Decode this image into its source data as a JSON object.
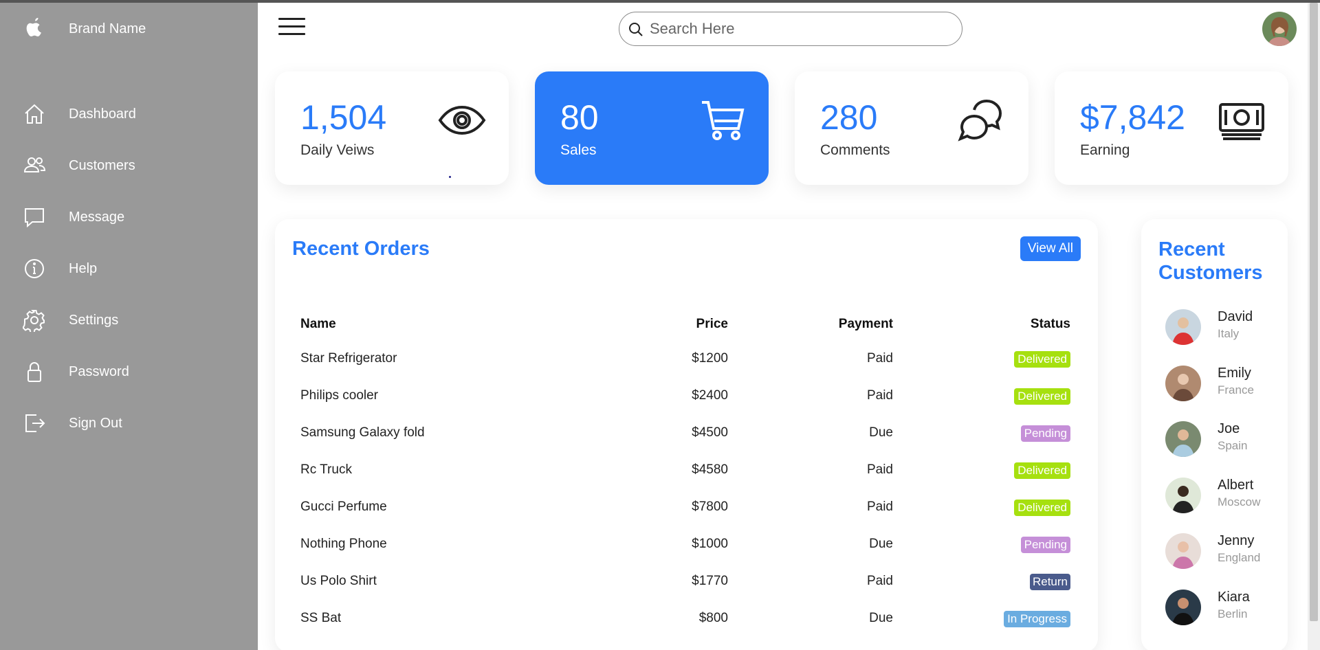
{
  "brand": {
    "name": "Brand Name",
    "logo_icon": "apple-icon"
  },
  "sidebar": {
    "items": [
      {
        "label": "Dashboard",
        "icon": "home-icon"
      },
      {
        "label": "Customers",
        "icon": "people-icon"
      },
      {
        "label": "Message",
        "icon": "chat-icon"
      },
      {
        "label": "Help",
        "icon": "info-icon"
      },
      {
        "label": "Settings",
        "icon": "gear-icon"
      },
      {
        "label": "Password",
        "icon": "lock-icon"
      },
      {
        "label": "Sign Out",
        "icon": "logout-icon"
      }
    ]
  },
  "search": {
    "placeholder": "Search Here"
  },
  "cards": [
    {
      "number": "1,504",
      "label": "Daily Veiws",
      "icon": "eye-icon"
    },
    {
      "number": "80",
      "label": "Sales",
      "icon": "cart-icon"
    },
    {
      "number": "280",
      "label": "Comments",
      "icon": "chat-bubbles-icon"
    },
    {
      "number": "$7,842",
      "label": "Earning",
      "icon": "cash-icon"
    }
  ],
  "orders": {
    "title": "Recent Orders",
    "view_all": "View All",
    "headers": {
      "name": "Name",
      "price": "Price",
      "payment": "Payment",
      "status": "Status"
    },
    "rows": [
      {
        "name": "Star Refrigerator",
        "price": "$1200",
        "payment": "Paid",
        "status": "Delivered"
      },
      {
        "name": "Philips cooler",
        "price": "$2400",
        "payment": "Paid",
        "status": "Delivered"
      },
      {
        "name": "Samsung Galaxy fold",
        "price": "$4500",
        "payment": "Due",
        "status": "Pending"
      },
      {
        "name": "Rc Truck",
        "price": "$4580",
        "payment": "Paid",
        "status": "Delivered"
      },
      {
        "name": "Gucci Perfume",
        "price": "$7800",
        "payment": "Paid",
        "status": "Delivered"
      },
      {
        "name": "Nothing Phone",
        "price": "$1000",
        "payment": "Due",
        "status": "Pending"
      },
      {
        "name": "Us Polo Shirt",
        "price": "$1770",
        "payment": "Paid",
        "status": "Return"
      },
      {
        "name": "SS Bat",
        "price": "$800",
        "payment": "Due",
        "status": "In Progress"
      }
    ]
  },
  "status_colors": {
    "Delivered": "#8de02c",
    "Pending": "#e9b10a",
    "Return": "#4a5b8c",
    "In Progress": "#5aa6e0"
  },
  "customers": {
    "title": "Recent Customers",
    "items": [
      {
        "name": "David",
        "country": "Italy"
      },
      {
        "name": "Emily",
        "country": "France"
      },
      {
        "name": "Joe",
        "country": "Spain"
      },
      {
        "name": "Albert",
        "country": "Moscow"
      },
      {
        "name": "Jenny",
        "country": "England"
      },
      {
        "name": "Kiara",
        "country": "Berlin"
      }
    ]
  },
  "colors": {
    "accent": "#2a7bf8",
    "sidebar": "#999999",
    "pending": "#c58fd8"
  }
}
